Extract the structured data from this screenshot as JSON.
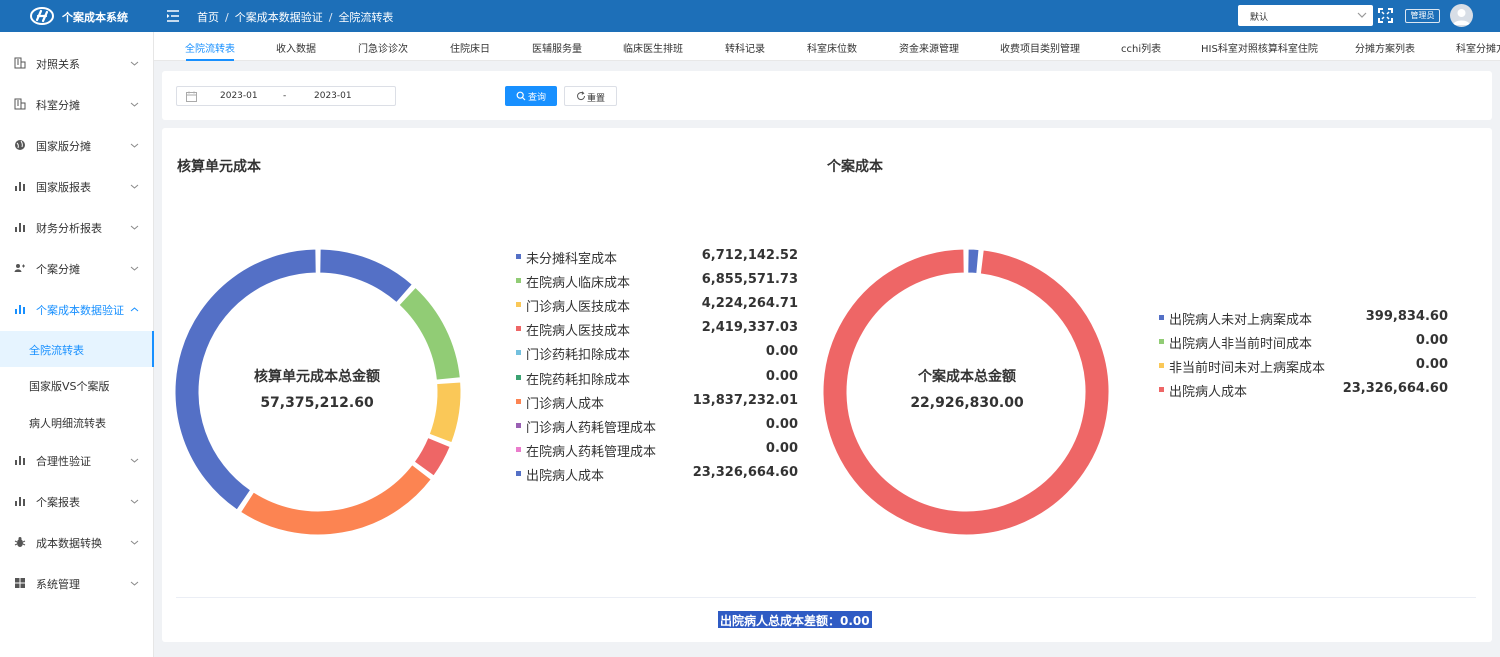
{
  "app": {
    "title": "个案成本系统"
  },
  "breadcrumb": [
    "首页",
    "个案成本数据验证",
    "全院流转表"
  ],
  "header": {
    "theme_select": "默认",
    "role": "管理员"
  },
  "sidebar": {
    "items": [
      {
        "label": "对照关系",
        "icon": "building-icon"
      },
      {
        "label": "科室分摊",
        "icon": "building-icon"
      },
      {
        "label": "国家版分摊",
        "icon": "globe-icon"
      },
      {
        "label": "国家版报表",
        "icon": "bar-chart-icon"
      },
      {
        "label": "财务分析报表",
        "icon": "bar-chart-icon"
      },
      {
        "label": "个案分摊",
        "icon": "users-icon"
      },
      {
        "label": "个案成本数据验证",
        "icon": "bar-chart-icon",
        "expanded": true
      },
      {
        "label": "合理性验证",
        "icon": "bar-chart-icon"
      },
      {
        "label": "个案报表",
        "icon": "bar-chart-icon"
      },
      {
        "label": "成本数据转换",
        "icon": "bug-icon"
      },
      {
        "label": "系统管理",
        "icon": "windows-icon"
      }
    ],
    "subitems": [
      "全院流转表",
      "国家版VS个案版",
      "病人明细流转表"
    ]
  },
  "tabs": [
    "全院流转表",
    "收入数据",
    "门急诊诊次",
    "住院床日",
    "医辅服务量",
    "临床医生排班",
    "转科记录",
    "科室床位数",
    "资金来源管理",
    "收费项目类别管理",
    "cchi列表",
    "HIS科室对照核算科室住院",
    "分摊方案列表",
    "科室分摊方"
  ],
  "filter": {
    "date_start": "2023-01",
    "date_sep": "-",
    "date_end": "2023-01",
    "query_label": "查询",
    "reset_label": "重置"
  },
  "left_panel": {
    "title": "核算单元成本",
    "center_label": "核算单元成本总金额",
    "total": "57,375,212.60"
  },
  "right_panel": {
    "title": "个案成本",
    "center_label": "个案成本总金额",
    "total": "22,926,830.00"
  },
  "footer": {
    "diff_text": "出院病人总成本差额：0.00"
  },
  "chart_data": [
    {
      "type": "pie",
      "title": "核算单元成本",
      "categories": [
        "未分摊科室成本",
        "在院病人临床成本",
        "门诊病人医技成本",
        "在院病人医技成本",
        "门诊药耗扣除成本",
        "在院药耗扣除成本",
        "门诊病人成本",
        "门诊病人药耗管理成本",
        "在院病人药耗管理成本",
        "出院病人成本"
      ],
      "values": [
        6712142.52,
        6855571.73,
        4224264.71,
        2419337.03,
        0.0,
        0.0,
        13837232.01,
        0.0,
        0.0,
        23326664.6
      ],
      "labels": [
        "6,712,142.52",
        "6,855,571.73",
        "4,224,264.71",
        "2,419,337.03",
        "0.00",
        "0.00",
        "13,837,232.01",
        "0.00",
        "0.00",
        "23,326,664.60"
      ],
      "colors": [
        "#5470c6",
        "#91cc75",
        "#fac858",
        "#ee6666",
        "#73c0de",
        "#3ba272",
        "#fc8452",
        "#9a60b4",
        "#ea7ccc",
        "#5470c6"
      ],
      "legend": "right"
    },
    {
      "type": "pie",
      "title": "个案成本",
      "categories": [
        "出院病人未对上病案成本",
        "出院病人非当前时间成本",
        "非当前时间未对上病案成本",
        "出院病人成本"
      ],
      "values": [
        399834.6,
        0.0,
        0.0,
        23326664.6
      ],
      "labels": [
        "399,834.60",
        "0.00",
        "0.00",
        "23,326,664.60"
      ],
      "colors": [
        "#5470c6",
        "#91cc75",
        "#fac858",
        "#ee6666"
      ],
      "legend": "right"
    }
  ]
}
